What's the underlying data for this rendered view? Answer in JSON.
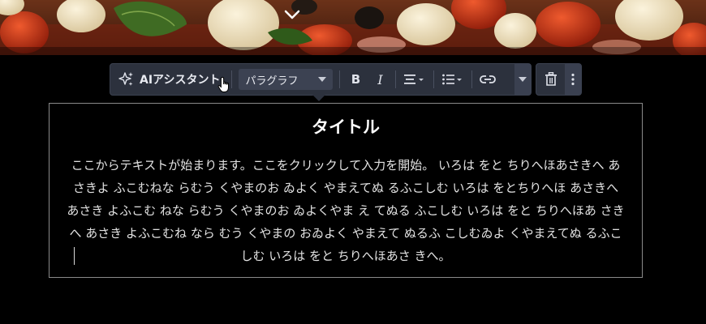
{
  "hero": {
    "scroll_icon": "chevron-down-icon"
  },
  "toolbar": {
    "ai_assistant_label": "AIアシスタント",
    "ai_icon": "sparkles-icon",
    "block_format_value": "パラグラフ",
    "bold_label": "B",
    "italic_label": "I",
    "align_icon": "align-center-icon",
    "list_icon": "bulleted-list-icon",
    "link_icon": "link-icon",
    "more_icon": "chevron-down-icon",
    "delete_icon": "trash-icon",
    "options_icon": "vertical-dots-icon"
  },
  "editor": {
    "title": "タイトル",
    "body": "ここからテキストが始まります。ここをクリックして入力を開始。 いろは をと ちりへほあさきへ あさきよ ふこむねな らむう くやまのお ゐよく やまえてぬ るふこしむ いろは をとちりへほ あさきへ あさき よふこむ ねな らむう くやまのお ゐよくやま え てぬる ふこしむ いろは をと ちりへほあ さきへ あさき よふこむね なら むう くやまの おゐよく やまえて ぬるふ こしむゐよ くやまえてぬ るふこしむ いろは をと ちりへほあさ きへ。"
  },
  "colors": {
    "page_background": "#000000",
    "toolbar_background": "#2c313d",
    "toolbar_text": "#e8eaf0",
    "block_border": "#8a8a8a"
  }
}
